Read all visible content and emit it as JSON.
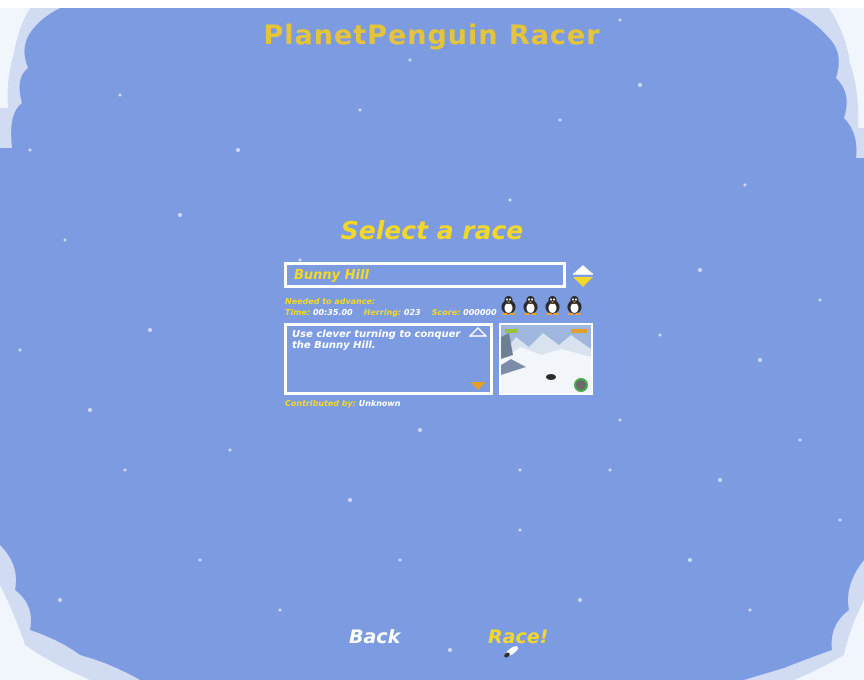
{
  "app": {
    "title": "PlanetPenguin Racer"
  },
  "screen": {
    "title": "Select a race"
  },
  "race": {
    "selected": "Bunny Hill"
  },
  "requirements": {
    "label": "Needed to advance:",
    "time_label": "Time:",
    "time": "00:35.00",
    "herring_label": "Herring:",
    "herring": "023",
    "score_label": "Score:",
    "score": "000000"
  },
  "difficulty_icons": [
    "penguin-icon",
    "penguin-icon",
    "penguin-icon",
    "penguin-icon"
  ],
  "description": "Use clever turning to conquer the Bunny Hill.",
  "contributor": {
    "label": "Contributed by:",
    "name": "Unknown"
  },
  "buttons": {
    "back": "Back",
    "race": "Race!"
  },
  "colors": {
    "background": "#7d9be0",
    "accent": "#f3d829",
    "title": "#e4c43a",
    "text": "#ffffff"
  }
}
